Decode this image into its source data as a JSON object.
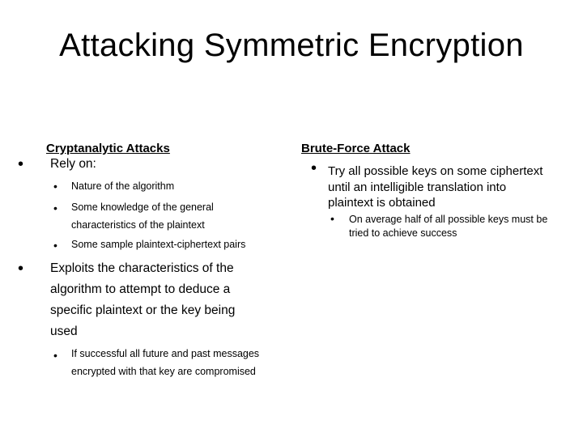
{
  "slide": {
    "title": "Attacking Symmetric Encryption"
  },
  "left": {
    "heading": "Cryptanalytic Attacks",
    "items": [
      {
        "text": "Rely on:",
        "subitems": [
          "Nature of the algorithm",
          "Some knowledge of the general characteristics of the plaintext",
          "Some sample plaintext-ciphertext pairs"
        ]
      },
      {
        "text": "Exploits the characteristics of the algorithm to attempt to deduce a specific plaintext or the key being used",
        "subitems": [
          "If successful all future and past messages encrypted with that key are compromised"
        ]
      }
    ]
  },
  "right": {
    "heading": "Brute-Force Attack",
    "items": [
      {
        "text": "Try all possible keys on some ciphertext until an intelligible translation into plaintext is obtained",
        "subitems": [
          "On average half of all possible keys must be tried to achieve success"
        ]
      }
    ]
  },
  "icons": {
    "bullet": "•"
  }
}
